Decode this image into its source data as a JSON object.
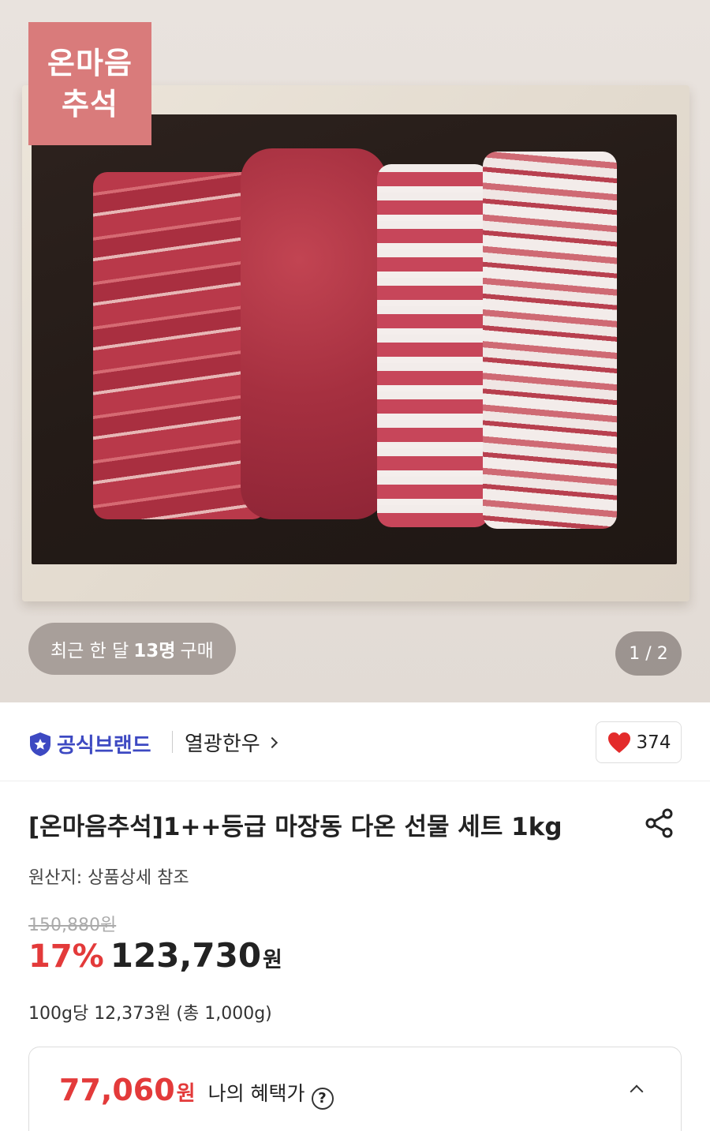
{
  "hero": {
    "badge": "온마음\n추석",
    "buyers_prefix": "최근 한 달",
    "buyers_count": "13명",
    "buyers_suffix": "구매",
    "image_counter": "1 / 2"
  },
  "brand": {
    "official_label": "공식브랜드",
    "store_name": "열광한우",
    "likes": "374"
  },
  "product": {
    "title": "[온마음추석]1++등급 마장동 다온 선물 세트 1kg",
    "origin": "원산지: 상품상세 참조",
    "original_price": "150,880원",
    "discount": "17%",
    "price": "123,730",
    "price_unit": "원",
    "unit_price": "100g당 12,373원 (총 1,000g)"
  },
  "benefit": {
    "price": "77,060",
    "price_unit": "원",
    "label": "나의 혜택가",
    "help": "?"
  },
  "colors": {
    "accent_red": "#e33a3a",
    "brand_blue": "#3d49c2",
    "badge_pink": "#d97b7b"
  }
}
